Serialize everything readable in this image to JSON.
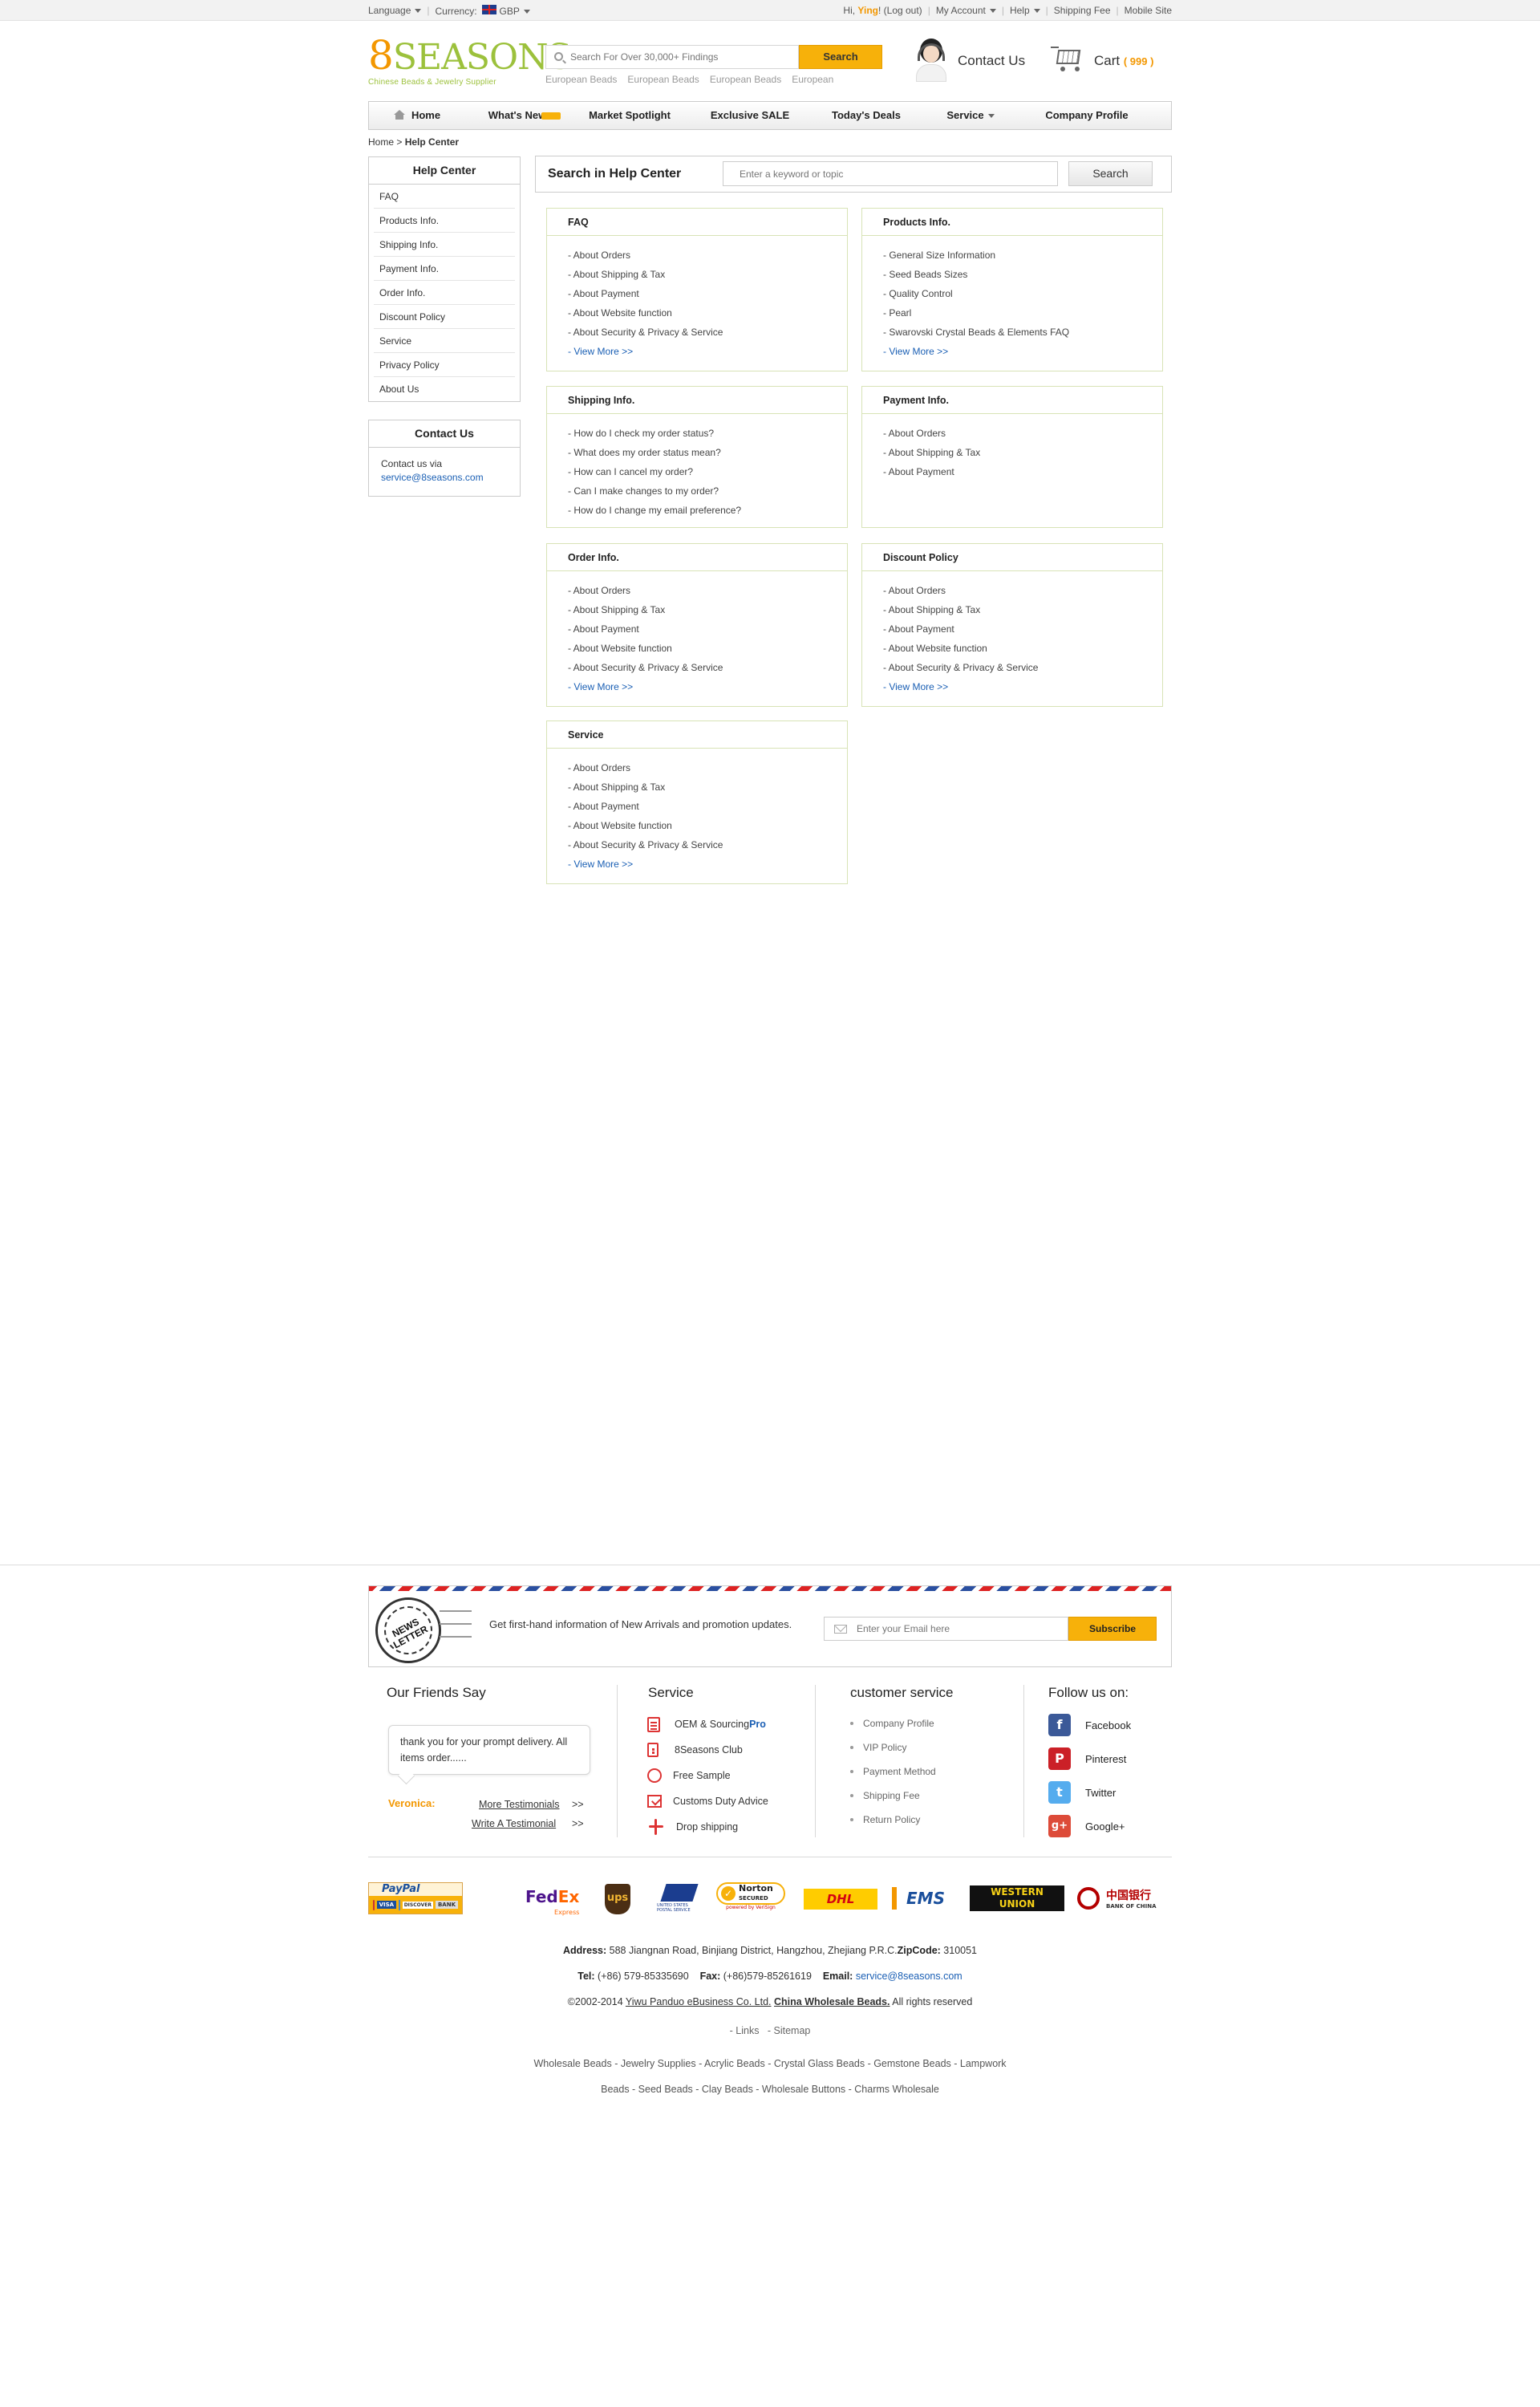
{
  "topbar": {
    "language_label": "Language",
    "currency_label": "Currency:",
    "currency_value": "GBP",
    "greeting_prefix": "Hi, ",
    "username": "Ying",
    "greeting_suffix": "! (Log out)",
    "my_account": "My Account",
    "help": "Help",
    "shipping_fee": "Shipping Fee",
    "mobile_site": "Mobile Site"
  },
  "brand": {
    "logo_num": "8",
    "logo_text": "SEASONS",
    "tagline": "Chinese Beads & Jewelry Supplier",
    "accent": "#f39700",
    "green": "#9cc13c"
  },
  "search": {
    "placeholder": "Search For Over 30,000+ Findings",
    "button": "Search",
    "hot_words": [
      "European Beads",
      "European Beads",
      "European Beads",
      "European"
    ]
  },
  "header": {
    "contact": "Contact Us",
    "cart_label": "Cart",
    "cart_count": "( 999 )"
  },
  "nav": {
    "items": [
      "Home",
      "What's New",
      "Market Spotlight",
      "Exclusive SALE",
      "Today's Deals",
      "Service",
      "Company Profile"
    ]
  },
  "breadcrumb": {
    "home": "Home",
    "sep": " > ",
    "current": "Help Center"
  },
  "sidebar": {
    "title": "Help Center",
    "items": [
      "FAQ",
      "Products Info.",
      "Shipping Info.",
      "Payment Info.",
      "Order Info.",
      "Discount Policy",
      "Service",
      "Privacy Policy",
      "About Us"
    ],
    "contact_title": "Contact Us",
    "contact_text": "Contact us via",
    "contact_email": "service@8seasons.com"
  },
  "help_search": {
    "title": "Search in Help Center",
    "placeholder": "Enter a keyword or topic",
    "button": "Search"
  },
  "cards": [
    {
      "title": "FAQ",
      "links": [
        "- About Orders",
        "- About Shipping & Tax",
        "- About Payment",
        "- About Website function",
        "- About Security & Privacy & Service"
      ],
      "more": "- View More >>"
    },
    {
      "title": "Products Info.",
      "links": [
        "- General Size Information",
        "- Seed Beads Sizes",
        "- Quality Control",
        "- Pearl",
        "- Swarovski Crystal Beads & Elements FAQ"
      ],
      "more": "- View More >>"
    },
    {
      "title": "Shipping Info.",
      "links": [
        "- How do I check my order status?",
        "- What does my order status mean?",
        "- How can I cancel my order?",
        "- Can I make changes to my order?",
        "- How do I change my email preference?"
      ],
      "more": ""
    },
    {
      "title": "Payment Info.",
      "links": [
        "- About Orders",
        "- About Shipping & Tax",
        "- About Payment"
      ],
      "more": ""
    },
    {
      "title": "Order Info.",
      "links": [
        "- About Orders",
        "- About Shipping & Tax",
        "- About Payment",
        "- About Website function",
        "- About Security & Privacy & Service"
      ],
      "more": "- View More >>"
    },
    {
      "title": "Discount Policy",
      "links": [
        "- About Orders",
        "- About Shipping & Tax",
        "- About Payment",
        "- About Website function",
        "- About Security & Privacy & Service"
      ],
      "more": "- View More >>"
    },
    {
      "title": "Service",
      "links": [
        "- About Orders",
        "- About Shipping & Tax",
        "- About Payment",
        "- About Website function",
        "- About Security & Privacy & Service"
      ],
      "more": "- View More >>"
    }
  ],
  "newsletter": {
    "stamp_text": "NEWS LETTER",
    "message": "Get first-hand information of New Arrivals and promotion updates.",
    "placeholder": "Enter your Email here",
    "button": "Subscribe"
  },
  "footer": {
    "friends_title": "Our Friends Say",
    "quote": "thank you for your prompt delivery. All items order......",
    "quote_author": "Veronica:",
    "more_testimonials": "More Testimonials",
    "write_testimonial": "Write A Testimonial",
    "arrow": ">>",
    "service_title": "Service",
    "service_items": [
      {
        "label": "OEM & Sourcing ",
        "extra": "Pro",
        "icon": "document-icon"
      },
      {
        "label": "8Seasons Club",
        "extra": "",
        "icon": "club-card-icon"
      },
      {
        "label": "Free Sample",
        "extra": "",
        "icon": "gift-icon"
      },
      {
        "label": "Customs Duty Advice",
        "extra": "",
        "icon": "checklist-icon"
      },
      {
        "label": "Drop shipping",
        "extra": "",
        "icon": "airplane-icon"
      }
    ],
    "cs_title": "customer service",
    "cs_items": [
      "Company Profile",
      "VIP Policy",
      "Payment Method",
      "Shipping Fee",
      "Return Policy"
    ],
    "follow_title": "Follow us on:",
    "social": [
      {
        "label": "Facebook",
        "glyph": "f",
        "color": "#3b5998"
      },
      {
        "label": "Pinterest",
        "glyph": "P",
        "color": "#cb2027"
      },
      {
        "label": "Twitter",
        "glyph": "t",
        "color": "#55acee"
      },
      {
        "label": "Google+",
        "glyph": "g+",
        "color": "#dd4b39"
      }
    ]
  },
  "payment_logos": {
    "paypal": "PayPal",
    "paypal_cards": [
      "VISA",
      "DISCOVER",
      "BANK"
    ],
    "fedex_a": "Fed",
    "fedex_b": "Ex",
    "fedex_sub": "Express",
    "ups": "ups",
    "usps": "UNITED STATES POSTAL SERVICE",
    "norton": "Norton",
    "norton_sub": "SECURED",
    "verisign": "powered by VeriSign",
    "dhl": "DHL",
    "ems": "EMS",
    "wu_1": "WESTERN",
    "wu_2": "UNION",
    "boc": "中国银行",
    "boc_sub": "BANK OF CHINA"
  },
  "footer_info": {
    "address_label": "Address:",
    "address": " 588 Jiangnan Road, Binjiang District, Hangzhou, Zhejiang P.R.C.",
    "zip_label": "ZipCode:",
    "zip": " 310051",
    "tel_label": "Tel:",
    "tel": " (+86) 579-85335690",
    "fax_label": "Fax:",
    "fax": " (+86)579-85261619",
    "email_label": "Email:",
    "email": "service@8seasons.com",
    "copyright": "©2002-2014 ",
    "company": "Yiwu Panduo eBusiness Co. Ltd.",
    "wholesale": "China Wholesale Beads.",
    "rights": " All rights reserved",
    "links": "- Links",
    "sitemap": "- Sitemap",
    "seo_line1": "Wholesale Beads - Jewelry Supplies - Acrylic Beads - Crystal Glass Beads - Gemstone Beads - Lampwork",
    "seo_line2": "Beads - Seed Beads - Clay Beads - Wholesale Buttons - Charms Wholesale"
  }
}
